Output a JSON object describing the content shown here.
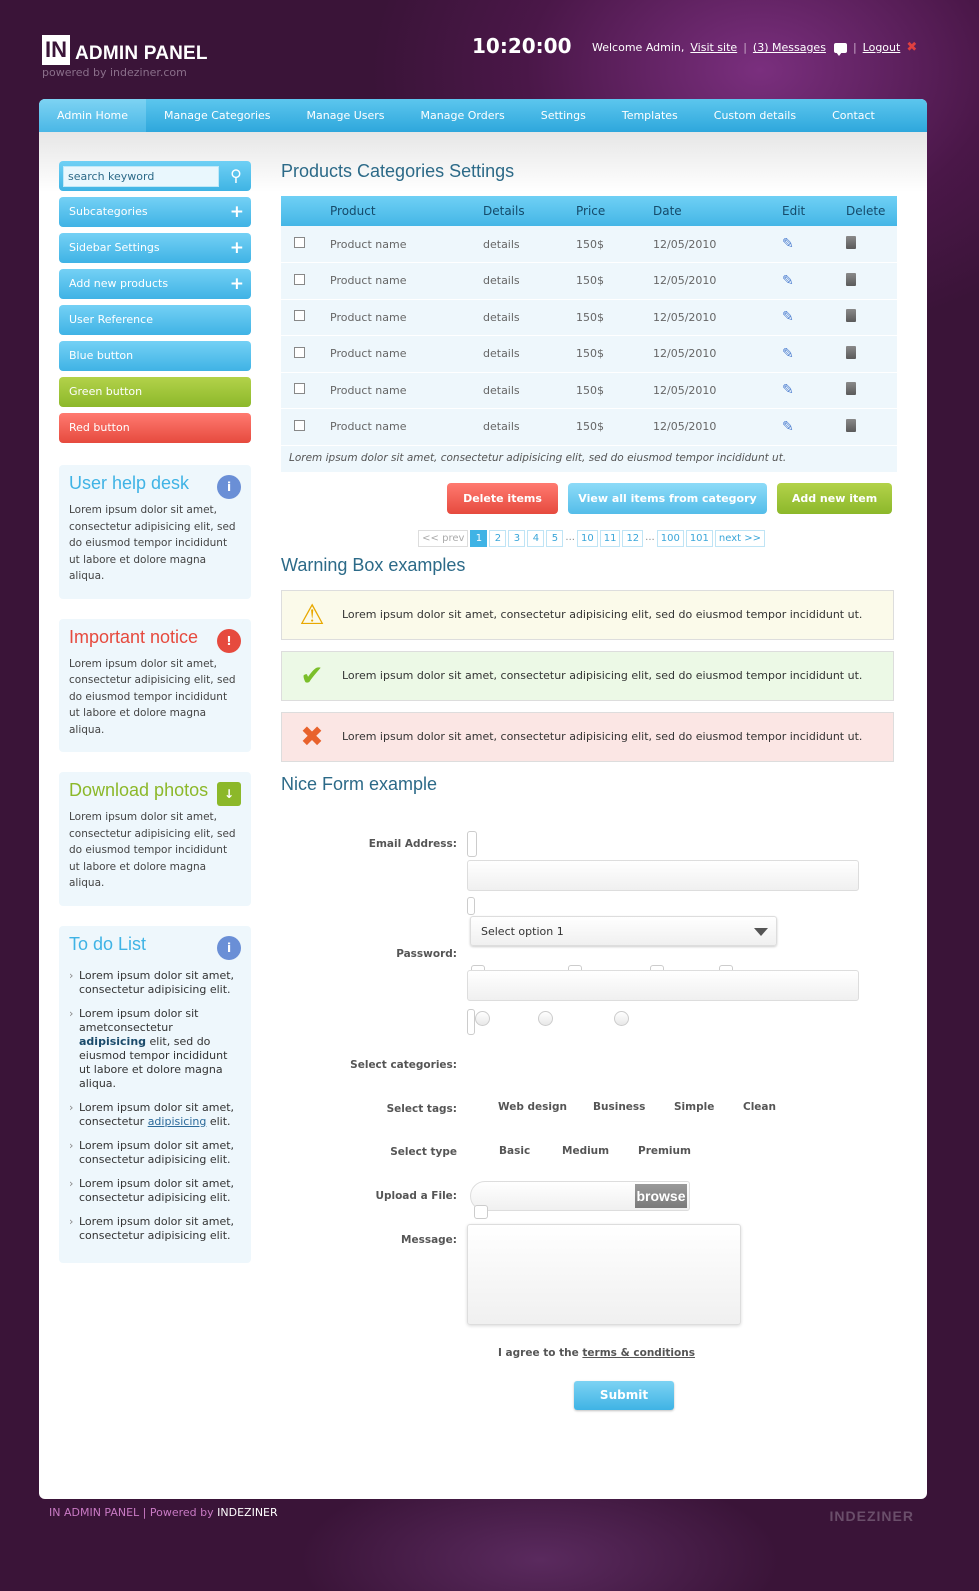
{
  "header": {
    "logo_box": "IN",
    "logo_text": "ADMIN PANEL",
    "logo_sub": "powered by indeziner.com",
    "clock": "10:20:00",
    "welcome": "Welcome Admin,",
    "visit_site": "Visit site",
    "messages": "(3) Messages",
    "logout": "Logout"
  },
  "nav": [
    "Admin Home",
    "Manage Categories",
    "Manage Users",
    "Manage Orders",
    "Settings",
    "Templates",
    "Custom details",
    "Contact"
  ],
  "sidebar": {
    "search_value": "search keyword",
    "buttons": [
      "Subcategories",
      "Sidebar Settings",
      "Add new products",
      "User Reference",
      "Blue button",
      "Green button",
      "Red button"
    ],
    "boxes": [
      {
        "title": "User help desk",
        "text": "Lorem ipsum dolor sit amet, consectetur adipisicing elit, sed do eiusmod tempor incididunt ut labore et dolore magna aliqua.",
        "color": "#3fb3e5"
      },
      {
        "title": "Important notice",
        "text": "Lorem ipsum dolor sit amet, consectetur adipisicing elit, sed do eiusmod tempor incididunt ut labore et dolore magna aliqua.",
        "color": "#e64a3e"
      },
      {
        "title": "Download photos",
        "text": "Lorem ipsum dolor sit amet, consectetur adipisicing elit, sed do eiusmod tempor incididunt ut labore et dolore magna aliqua.",
        "color": "#8cb82a"
      }
    ],
    "todo_title": "To do List",
    "todo": [
      {
        "a": "Lorem ipsum dolor sit amet, consectetur adipisicing elit."
      },
      {
        "a": "Lorem ipsum dolor sit ametconsectetur ",
        "b": "adipisicing",
        "c": " elit, sed do eiusmod tempor incididunt ut labore et dolore magna aliqua."
      },
      {
        "a": "Lorem ipsum dolor sit amet, consectetur ",
        "link": "adipisicing",
        "c": " elit."
      },
      {
        "a": "Lorem ipsum dolor sit amet, consectetur adipisicing elit."
      },
      {
        "a": "Lorem ipsum dolor sit amet, consectetur adipisicing elit."
      },
      {
        "a": "Lorem ipsum dolor sit amet, consectetur adipisicing elit."
      }
    ]
  },
  "main": {
    "title": "Products Categories Settings",
    "columns": [
      "Product",
      "Details",
      "Price",
      "Date",
      "Edit",
      "Delete"
    ],
    "rows": [
      {
        "product": "Product name",
        "details": "details",
        "price": "150$",
        "date": "12/05/2010"
      },
      {
        "product": "Product name",
        "details": "details",
        "price": "150$",
        "date": "12/05/2010"
      },
      {
        "product": "Product name",
        "details": "details",
        "price": "150$",
        "date": "12/05/2010"
      },
      {
        "product": "Product name",
        "details": "details",
        "price": "150$",
        "date": "12/05/2010"
      },
      {
        "product": "Product name",
        "details": "details",
        "price": "150$",
        "date": "12/05/2010"
      },
      {
        "product": "Product name",
        "details": "details",
        "price": "150$",
        "date": "12/05/2010"
      }
    ],
    "table_note": "Lorem ipsum dolor sit amet, consectetur adipisicing elit, sed do eiusmod tempor incididunt ut.",
    "actions": [
      "Delete items",
      "View all items from category",
      "Add new item"
    ],
    "pager": {
      "prev": "<< prev",
      "pages": [
        "1",
        "2",
        "3",
        "4",
        "5",
        "...",
        "10",
        "11",
        "12",
        "...",
        "100",
        "101"
      ],
      "next": "next >>",
      "current": "1"
    },
    "warn_title": "Warning Box examples",
    "warn_boxes": [
      {
        "type": "warning",
        "text": "Lorem ipsum dolor sit amet, consectetur adipisicing elit, sed do eiusmod tempor incididunt ut."
      },
      {
        "type": "success",
        "text": "Lorem ipsum dolor sit amet, consectetur adipisicing elit, sed do eiusmod tempor incididunt ut."
      },
      {
        "type": "error",
        "text": "Lorem ipsum dolor sit amet, consectetur adipisicing elit, sed do eiusmod tempor incididunt ut."
      }
    ],
    "form_title": "Nice Form example",
    "form": {
      "email_label": "Email Address:",
      "password_label": "Password:",
      "select_value": "Select option 1",
      "categories_label": "Select categories:",
      "tags_label": "Select tags:",
      "tags": [
        "Web design",
        "Business",
        "Simple",
        "Clean"
      ],
      "type_label": "Select type",
      "types": [
        "Basic",
        "Medium",
        "Premium"
      ],
      "upload_label": "Upload a File:",
      "browse": "browse",
      "message_label": "Message:",
      "agree": "I agree to the",
      "terms": "terms & conditions",
      "submit": "Submit"
    }
  },
  "footer": {
    "left": "IN ADMIN PANEL | Powered by ",
    "brand": "INDEZINER",
    "logo": "INDEZINER"
  }
}
